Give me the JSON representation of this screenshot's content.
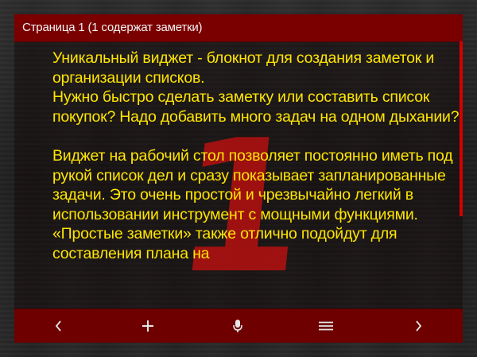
{
  "header": {
    "title": "Страница 1 (1 содержат заметки)"
  },
  "note": {
    "page_number": "1",
    "paragraphs": [
      "Уникальный виджет - блокнот для создания заметок и организации списков.",
      "Нужно быстро сделать заметку или составить список покупок? Надо добавить много задач на одном дыхании?",
      "",
      "Виджет на рабочий стол позволяет постоянно иметь под рукой список дел и сразу показывает запланированные задачи. Это очень простой и чрезвычайно легкий в использовании инструмент с мощными функциями. «Простые заметки» также отлично подойдут для составления плана на"
    ]
  },
  "toolbar": {
    "buttons": [
      {
        "name": "prev-page-button",
        "icon": "chevron-left-icon"
      },
      {
        "name": "add-note-button",
        "icon": "plus-icon"
      },
      {
        "name": "voice-input-button",
        "icon": "microphone-icon"
      },
      {
        "name": "menu-button",
        "icon": "hamburger-menu-icon"
      },
      {
        "name": "next-page-button",
        "icon": "chevron-right-icon"
      }
    ]
  },
  "colors": {
    "header_bg": "#7a0000",
    "toolbar_bg": "#6e0000",
    "text": "#ffe600",
    "page_number": "#c41010",
    "scrollbar": "#d40000"
  }
}
